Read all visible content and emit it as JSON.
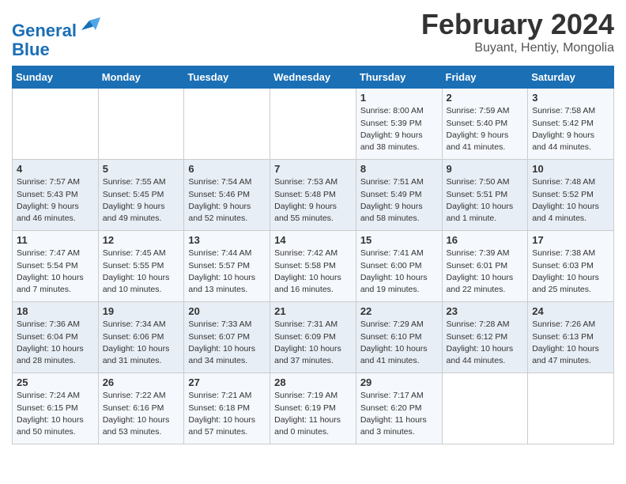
{
  "header": {
    "logo_general": "General",
    "logo_blue": "Blue",
    "month_title": "February 2024",
    "location": "Buyant, Hentiy, Mongolia"
  },
  "weekdays": [
    "Sunday",
    "Monday",
    "Tuesday",
    "Wednesday",
    "Thursday",
    "Friday",
    "Saturday"
  ],
  "weeks": [
    [
      {
        "day": "",
        "info": ""
      },
      {
        "day": "",
        "info": ""
      },
      {
        "day": "",
        "info": ""
      },
      {
        "day": "",
        "info": ""
      },
      {
        "day": "1",
        "info": "Sunrise: 8:00 AM\nSunset: 5:39 PM\nDaylight: 9 hours\nand 38 minutes."
      },
      {
        "day": "2",
        "info": "Sunrise: 7:59 AM\nSunset: 5:40 PM\nDaylight: 9 hours\nand 41 minutes."
      },
      {
        "day": "3",
        "info": "Sunrise: 7:58 AM\nSunset: 5:42 PM\nDaylight: 9 hours\nand 44 minutes."
      }
    ],
    [
      {
        "day": "4",
        "info": "Sunrise: 7:57 AM\nSunset: 5:43 PM\nDaylight: 9 hours\nand 46 minutes."
      },
      {
        "day": "5",
        "info": "Sunrise: 7:55 AM\nSunset: 5:45 PM\nDaylight: 9 hours\nand 49 minutes."
      },
      {
        "day": "6",
        "info": "Sunrise: 7:54 AM\nSunset: 5:46 PM\nDaylight: 9 hours\nand 52 minutes."
      },
      {
        "day": "7",
        "info": "Sunrise: 7:53 AM\nSunset: 5:48 PM\nDaylight: 9 hours\nand 55 minutes."
      },
      {
        "day": "8",
        "info": "Sunrise: 7:51 AM\nSunset: 5:49 PM\nDaylight: 9 hours\nand 58 minutes."
      },
      {
        "day": "9",
        "info": "Sunrise: 7:50 AM\nSunset: 5:51 PM\nDaylight: 10 hours\nand 1 minute."
      },
      {
        "day": "10",
        "info": "Sunrise: 7:48 AM\nSunset: 5:52 PM\nDaylight: 10 hours\nand 4 minutes."
      }
    ],
    [
      {
        "day": "11",
        "info": "Sunrise: 7:47 AM\nSunset: 5:54 PM\nDaylight: 10 hours\nand 7 minutes."
      },
      {
        "day": "12",
        "info": "Sunrise: 7:45 AM\nSunset: 5:55 PM\nDaylight: 10 hours\nand 10 minutes."
      },
      {
        "day": "13",
        "info": "Sunrise: 7:44 AM\nSunset: 5:57 PM\nDaylight: 10 hours\nand 13 minutes."
      },
      {
        "day": "14",
        "info": "Sunrise: 7:42 AM\nSunset: 5:58 PM\nDaylight: 10 hours\nand 16 minutes."
      },
      {
        "day": "15",
        "info": "Sunrise: 7:41 AM\nSunset: 6:00 PM\nDaylight: 10 hours\nand 19 minutes."
      },
      {
        "day": "16",
        "info": "Sunrise: 7:39 AM\nSunset: 6:01 PM\nDaylight: 10 hours\nand 22 minutes."
      },
      {
        "day": "17",
        "info": "Sunrise: 7:38 AM\nSunset: 6:03 PM\nDaylight: 10 hours\nand 25 minutes."
      }
    ],
    [
      {
        "day": "18",
        "info": "Sunrise: 7:36 AM\nSunset: 6:04 PM\nDaylight: 10 hours\nand 28 minutes."
      },
      {
        "day": "19",
        "info": "Sunrise: 7:34 AM\nSunset: 6:06 PM\nDaylight: 10 hours\nand 31 minutes."
      },
      {
        "day": "20",
        "info": "Sunrise: 7:33 AM\nSunset: 6:07 PM\nDaylight: 10 hours\nand 34 minutes."
      },
      {
        "day": "21",
        "info": "Sunrise: 7:31 AM\nSunset: 6:09 PM\nDaylight: 10 hours\nand 37 minutes."
      },
      {
        "day": "22",
        "info": "Sunrise: 7:29 AM\nSunset: 6:10 PM\nDaylight: 10 hours\nand 41 minutes."
      },
      {
        "day": "23",
        "info": "Sunrise: 7:28 AM\nSunset: 6:12 PM\nDaylight: 10 hours\nand 44 minutes."
      },
      {
        "day": "24",
        "info": "Sunrise: 7:26 AM\nSunset: 6:13 PM\nDaylight: 10 hours\nand 47 minutes."
      }
    ],
    [
      {
        "day": "25",
        "info": "Sunrise: 7:24 AM\nSunset: 6:15 PM\nDaylight: 10 hours\nand 50 minutes."
      },
      {
        "day": "26",
        "info": "Sunrise: 7:22 AM\nSunset: 6:16 PM\nDaylight: 10 hours\nand 53 minutes."
      },
      {
        "day": "27",
        "info": "Sunrise: 7:21 AM\nSunset: 6:18 PM\nDaylight: 10 hours\nand 57 minutes."
      },
      {
        "day": "28",
        "info": "Sunrise: 7:19 AM\nSunset: 6:19 PM\nDaylight: 11 hours\nand 0 minutes."
      },
      {
        "day": "29",
        "info": "Sunrise: 7:17 AM\nSunset: 6:20 PM\nDaylight: 11 hours\nand 3 minutes."
      },
      {
        "day": "",
        "info": ""
      },
      {
        "day": "",
        "info": ""
      }
    ]
  ]
}
